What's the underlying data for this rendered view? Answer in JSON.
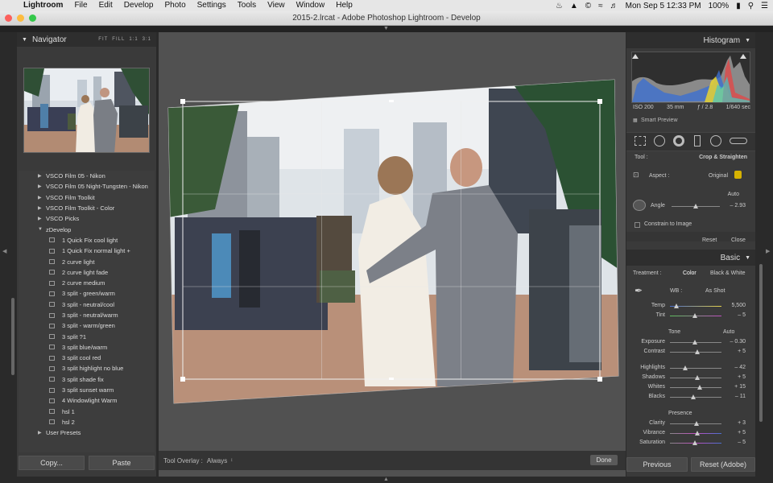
{
  "menubar": {
    "app": "Lightroom",
    "menus": [
      "File",
      "Edit",
      "Develop",
      "Photo",
      "Settings",
      "Tools",
      "View",
      "Window",
      "Help"
    ],
    "clock": "Mon Sep 5  12:33 PM",
    "battery": "100%"
  },
  "window": {
    "title": "2015-2.lrcat - Adobe Photoshop Lightroom - Develop"
  },
  "navigator": {
    "title": "Navigator",
    "zoom_options": [
      "FIT",
      "FILL",
      "1:1",
      "3:1"
    ]
  },
  "presets": [
    {
      "label": "VSCO Film 05 - Nikon",
      "group": true,
      "expanded": false
    },
    {
      "label": "VSCO Film 05 Night-Tungsten - Nikon",
      "group": true,
      "expanded": false
    },
    {
      "label": "VSCO Film Toolkit",
      "group": true,
      "expanded": false
    },
    {
      "label": "VSCO Film Toolkit - Color",
      "group": true,
      "expanded": false
    },
    {
      "label": "VSCO Picks",
      "group": true,
      "expanded": false
    },
    {
      "label": "zDevelop",
      "group": true,
      "expanded": true
    },
    {
      "label": "1 Quick Fix cool light",
      "group": false
    },
    {
      "label": "1 Quick Fix normal light  +",
      "group": false
    },
    {
      "label": "2 curve light",
      "group": false
    },
    {
      "label": "2 curve light fade",
      "group": false
    },
    {
      "label": "2 curve medium",
      "group": false
    },
    {
      "label": "3 split - green/warm",
      "group": false
    },
    {
      "label": "3 split - neutral/cool",
      "group": false
    },
    {
      "label": "3 split - neutral/warm",
      "group": false
    },
    {
      "label": "3 split - warm/green",
      "group": false
    },
    {
      "label": "3 split ?1",
      "group": false
    },
    {
      "label": "3 split blue/warm",
      "group": false
    },
    {
      "label": "3 split cool red",
      "group": false
    },
    {
      "label": "3 split highlight no blue",
      "group": false
    },
    {
      "label": "3 split shade fix",
      "group": false
    },
    {
      "label": "3 split sunset warm",
      "group": false
    },
    {
      "label": "4 Windowlight Warm",
      "group": false
    },
    {
      "label": "hsl 1",
      "group": false
    },
    {
      "label": "hsl 2",
      "group": false
    },
    {
      "label": "User Presets",
      "group": true,
      "expanded": false
    }
  ],
  "left_buttons": {
    "copy": "Copy...",
    "paste": "Paste"
  },
  "toolbar": {
    "overlay_label": "Tool Overlay :",
    "overlay_value": "Always",
    "done": "Done"
  },
  "histogram": {
    "title": "Histogram",
    "iso": "ISO 200",
    "focal": "35 mm",
    "aperture": "ƒ / 2.8",
    "shutter": "1/640 sec",
    "smart_preview": "Smart Preview"
  },
  "crop": {
    "tool_label": "Tool :",
    "tool_name": "Crop & Straighten",
    "aspect_label": "Aspect :",
    "aspect_value": "Original",
    "auto": "Auto",
    "angle_label": "Angle",
    "angle_value": "– 2.93",
    "constrain": "Constrain to Image",
    "reset": "Reset",
    "close": "Close"
  },
  "basic": {
    "title": "Basic",
    "treatment_label": "Treatment :",
    "color": "Color",
    "bw": "Black & White",
    "wb_label": "WB :",
    "wb_value": "As Shot",
    "temp_label": "Temp",
    "temp_value": "5,500",
    "tint_label": "Tint",
    "tint_value": "– 5",
    "tone_label": "Tone",
    "tone_auto": "Auto",
    "exposure_label": "Exposure",
    "exposure_value": "– 0.30",
    "contrast_label": "Contrast",
    "contrast_value": "+ 5",
    "highlights_label": "Highlights",
    "highlights_value": "– 42",
    "shadows_label": "Shadows",
    "shadows_value": "+ 5",
    "whites_label": "Whites",
    "whites_value": "+ 15",
    "blacks_label": "Blacks",
    "blacks_value": "– 11",
    "presence_label": "Presence",
    "clarity_label": "Clarity",
    "clarity_value": "+ 3",
    "vibrance_label": "Vibrance",
    "vibrance_value": "+ 5",
    "saturation_label": "Saturation",
    "saturation_value": "– 5"
  },
  "right_buttons": {
    "previous": "Previous",
    "reset": "Reset (Adobe)"
  },
  "colors": {
    "panel": "#3a3a3a",
    "header": "#2e2e2e",
    "canvas": "#515151",
    "accent": "#e6c200"
  }
}
